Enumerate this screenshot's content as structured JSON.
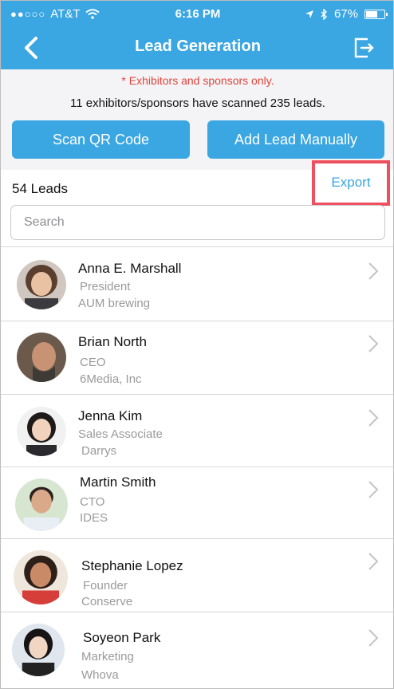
{
  "status": {
    "carrier": "AT&T",
    "time": "6:16 PM",
    "battery": "67%"
  },
  "nav": {
    "title": "Lead Generation"
  },
  "notice": {
    "warning": "* Exhibitors and sponsors only.",
    "summary": "11 exhibitors/sponsors have scanned 235 leads."
  },
  "buttons": {
    "scan": "Scan QR Code",
    "add": "Add Lead Manually"
  },
  "leads": {
    "count_label": "54 Leads",
    "export": "Export"
  },
  "search": {
    "placeholder": "Search"
  },
  "contacts": [
    {
      "name": "Anna E. Marshall",
      "title": "President",
      "company": "AUM brewing"
    },
    {
      "name": "Brian North",
      "title": "CEO",
      "company": "6Media, Inc"
    },
    {
      "name": "Jenna Kim",
      "title": "Sales Associate",
      "company": "Darrys"
    },
    {
      "name": "Martin Smith",
      "title": "CTO",
      "company": "IDES"
    },
    {
      "name": "Stephanie Lopez",
      "title": "Founder",
      "company": "Conserve"
    },
    {
      "name": "Soyeon Park",
      "title": "Marketing",
      "company": "Whova"
    }
  ],
  "colors": {
    "accent": "#3aa6e2",
    "warning": "#e0453c",
    "highlight": "#ef4f5f"
  }
}
